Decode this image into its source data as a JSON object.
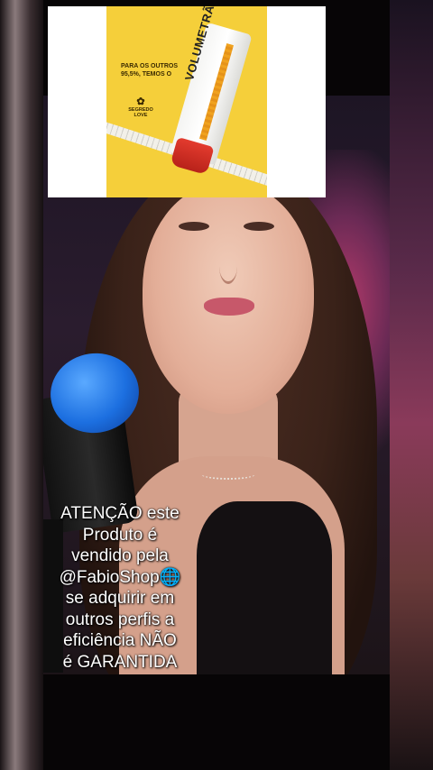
{
  "ad": {
    "tagline": "PARA OS OUTROS 95,5%, TEMOS O",
    "logo": "SEGREDO LOVE",
    "product_brand": "VOLUMETRÃO",
    "colors": {
      "background": "#f5cf3a",
      "cap": "#e33b2e"
    }
  },
  "caption": {
    "lines": [
      "ATENÇÃO este",
      "Produto é",
      "vendido pela",
      "@FabioShop🌐",
      "se adquirir em",
      "outros perfis a",
      "eficiência NÃO",
      "é GARANTIDA"
    ]
  }
}
